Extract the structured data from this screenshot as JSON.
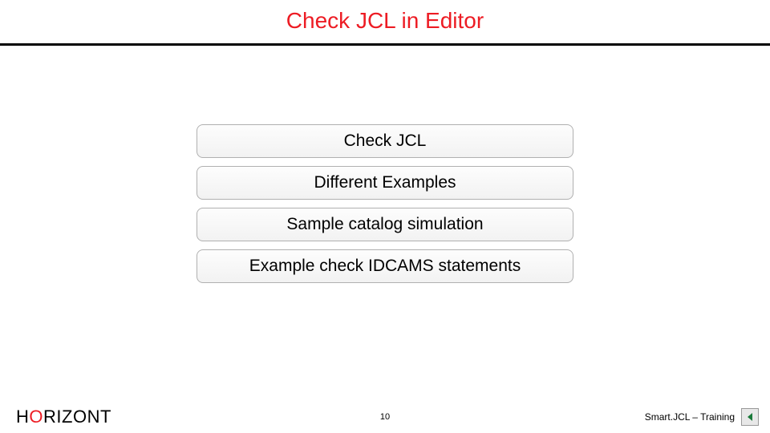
{
  "header": {
    "title": "Check JCL in Editor"
  },
  "buttons": [
    {
      "label": "Check JCL"
    },
    {
      "label": "Different Examples"
    },
    {
      "label": "Sample catalog simulation"
    },
    {
      "label": "Example check IDCAMS statements"
    }
  ],
  "footer": {
    "logo_h": "H",
    "logo_o": "O",
    "logo_rest": "RIZONT",
    "page_number": "10",
    "product_name": "Smart.JCL – Training"
  }
}
